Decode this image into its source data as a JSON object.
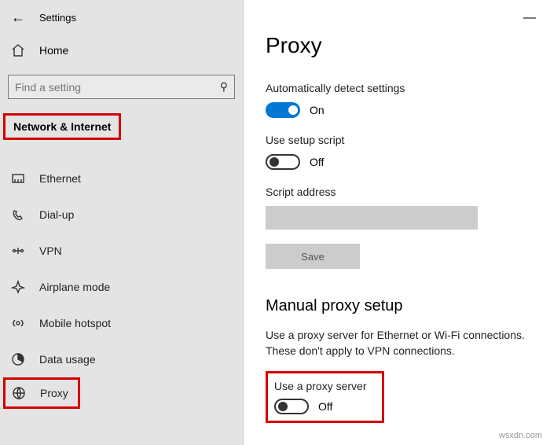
{
  "header": {
    "settings": "Settings"
  },
  "home_label": "Home",
  "search": {
    "placeholder": "Find a setting"
  },
  "category_title": "Network & Internet",
  "nav": {
    "ethernet": "Ethernet",
    "dialup": "Dial-up",
    "vpn": "VPN",
    "airplane": "Airplane mode",
    "hotspot": "Mobile hotspot",
    "datausage": "Data usage",
    "proxy": "Proxy"
  },
  "page_title": "Proxy",
  "auto": {
    "detect_label": "Automatically detect settings",
    "detect_state": "On",
    "script_label": "Use setup script",
    "script_state": "Off",
    "address_label": "Script address",
    "save": "Save"
  },
  "manual": {
    "title": "Manual proxy setup",
    "desc": "Use a proxy server for Ethernet or Wi-Fi connections. These don't apply to VPN connections.",
    "use_label": "Use a proxy server",
    "use_state": "Off"
  },
  "watermark": "wsxdn.com"
}
